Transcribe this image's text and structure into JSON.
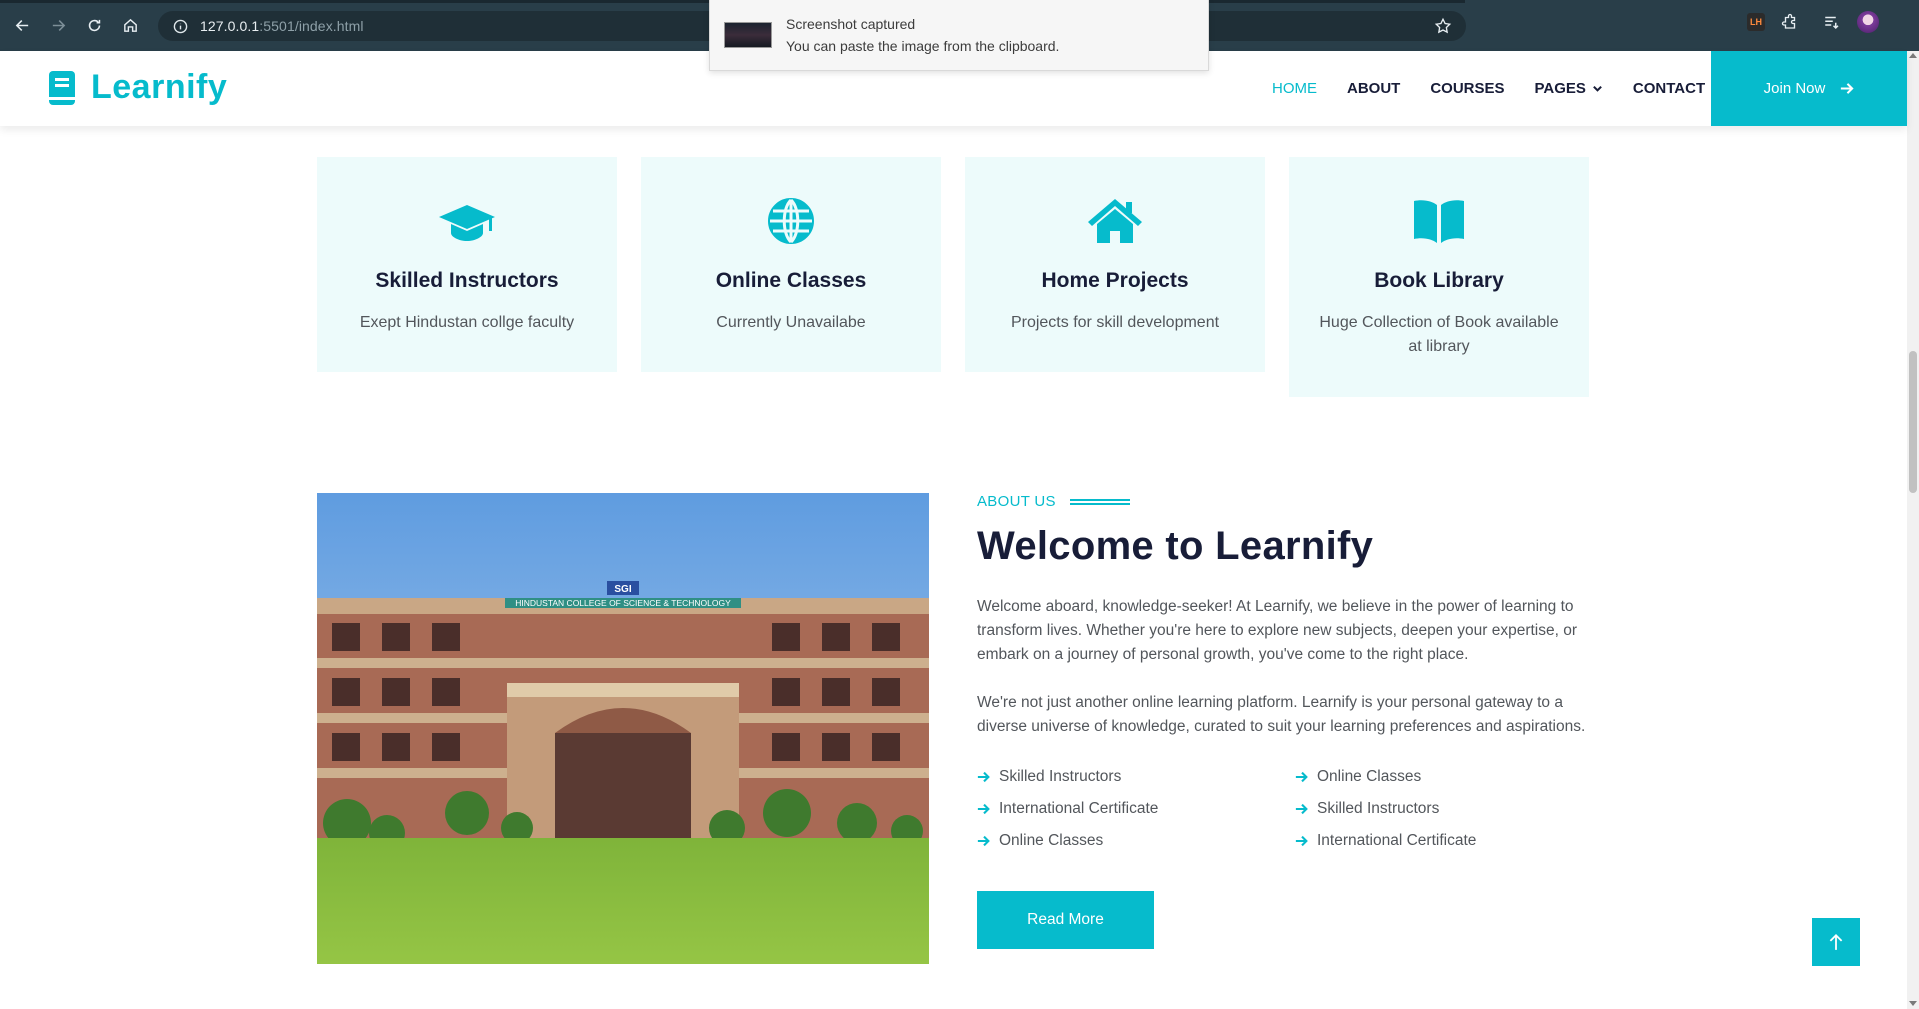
{
  "browser": {
    "url_host": "127.0.0.1",
    "url_rest": ":5501/index.html",
    "icons": [
      "back-icon",
      "forward-icon",
      "reload-icon",
      "home-icon",
      "site-info-icon",
      "bookmark-star-icon",
      "extension-lh-icon",
      "extensions-puzzle-icon",
      "reading-list-icon",
      "profile-avatar-icon"
    ],
    "ext_lh_label": "LH"
  },
  "toast": {
    "title": "Screenshot captured",
    "message": "You can paste the image from the clipboard."
  },
  "header": {
    "logo_text": "Learnify",
    "nav": [
      {
        "label": "HOME",
        "active": true
      },
      {
        "label": "ABOUT"
      },
      {
        "label": "COURSES"
      },
      {
        "label": "PAGES"
      },
      {
        "label": "CONTACT"
      }
    ],
    "join_label": "Join Now"
  },
  "cards": [
    {
      "title": "Skilled Instructors",
      "desc": "Exept Hindustan collge faculty",
      "icon": "graduation-cap-icon"
    },
    {
      "title": "Online Classes",
      "desc": "Currently Unavailabe",
      "icon": "globe-icon"
    },
    {
      "title": "Home Projects",
      "desc": "Projects for skill development",
      "icon": "house-icon"
    },
    {
      "title": "Book Library",
      "desc": "Huge Collection of Book available at library",
      "icon": "book-open-icon"
    }
  ],
  "about": {
    "eyebrow": "ABOUT US",
    "title": "Welcome to Learnify",
    "paragraph1": "Welcome aboard, knowledge-seeker! At Learnify, we believe in the power of learning to transform lives. Whether you're here to explore new subjects, deepen your expertise, or embark on a journey of personal growth, you've come to the right place.",
    "paragraph2": "We're not just another online learning platform. Learnify is your personal gateway to a diverse universe of knowledge, curated to suit your learning preferences and aspirations.",
    "features": [
      "Skilled Instructors",
      "Online Classes",
      "International Certificate",
      "Skilled Instructors",
      "Online Classes",
      "International Certificate"
    ],
    "read_more": "Read More",
    "image_sign_text": "HINDUSTAN COLLEGE OF SCIENCE & TECHNOLOGY",
    "image_logo_text": "SGI"
  },
  "colors": {
    "primary": "#06bbcc",
    "heading": "#181d38",
    "card_bg": "#edfbfb",
    "chrome_bg": "#293e49"
  }
}
